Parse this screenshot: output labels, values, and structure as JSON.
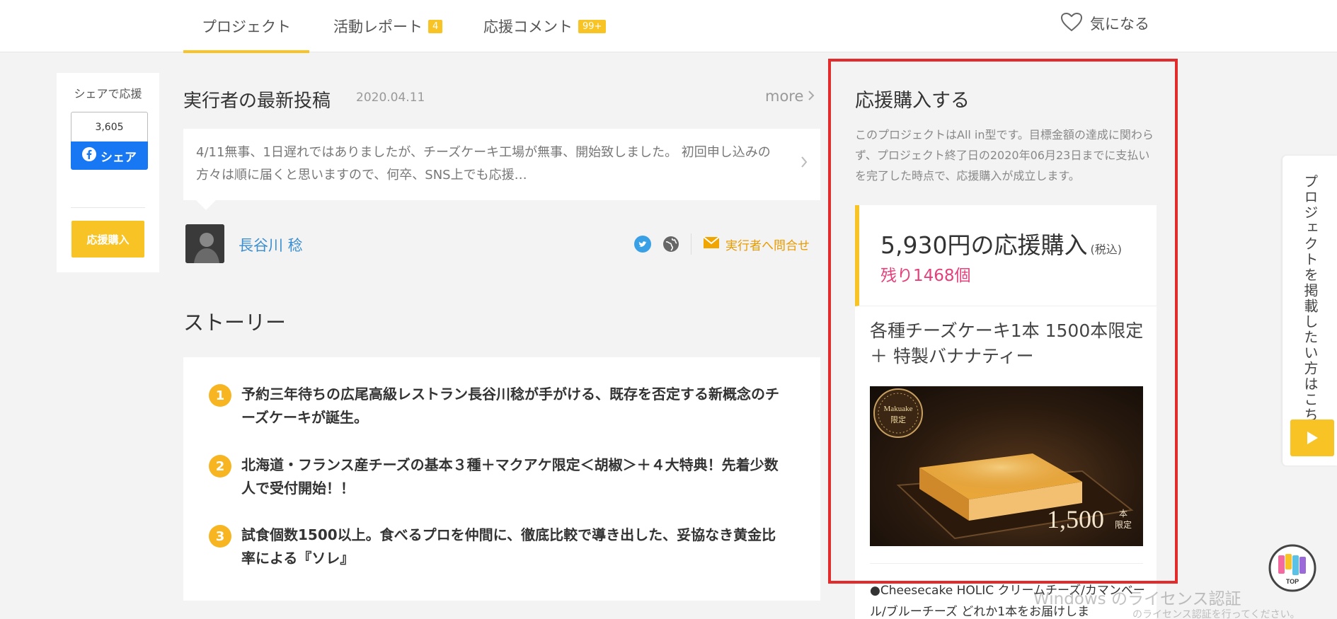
{
  "nav": {
    "tabs": [
      {
        "label": "プロジェクト",
        "badge": ""
      },
      {
        "label": "活動レポート",
        "badge": "4"
      },
      {
        "label": "応援コメント",
        "badge": "99+"
      }
    ],
    "favorite_label": "気になる"
  },
  "share": {
    "title": "シェアで応援",
    "count": "3,605",
    "fb_label": "シェア",
    "buy_label": "応援購入"
  },
  "latest": {
    "title": "実行者の最新投稿",
    "date": "2020.04.11",
    "more_label": "more",
    "post_text": "4/11無事、1日遅れではありましたが、チーズケーキ工場が無事、開始致しました。 初回申し込みの方々は順に届くと思いますので、何卒、SNS上でも応援…"
  },
  "author": {
    "name": "長谷川 稔",
    "contact_label": "実行者へ問合せ"
  },
  "story": {
    "title": "ストーリー",
    "items": [
      {
        "num": "1",
        "text": "予約三年待ちの広尾高級レストラン長谷川稔が手がける、既存を否定する新概念のチーズケーキが誕生。"
      },
      {
        "num": "2",
        "text": "北海道・フランス産チーズの基本３種＋マクアケ限定＜胡椒＞＋４大特典！先着少数人で受付開始！！"
      },
      {
        "num": "3",
        "text": "試食個数1500以上。食べるプロを仲間に、徹底比較で導き出した、妥協なき黄金比率による『ソレ』"
      }
    ]
  },
  "purchase": {
    "title": "応援購入する",
    "description": "このプロジェクトはAll in型です。目標金額の達成に関わらず、プロジェクト終了日の2020年06月23日までに支払いを完了した時点で、応援購入が成立します。",
    "reward": {
      "price": "5,930円の応援購入",
      "tax": "(税込)",
      "remaining": "残り1468個",
      "name": "各種チーズケーキ1本 1500本限定 ＋ 特製バナナティー",
      "image_badge_line1": "Makuake",
      "image_badge_line2": "限定",
      "image_count": "1,500",
      "image_count_unit1": "本",
      "image_count_unit2": "限定",
      "detail": "●Cheesecake HOLIC クリームチーズ/カマンベール/ブルーチーズ どれか1本をお届けしま"
    }
  },
  "side_tab": {
    "label": "プロジェクトを掲載したい方はこちら"
  },
  "top_button": {
    "label": "TOP"
  },
  "watermark": {
    "line1": "Windows のライセンス認証",
    "line2": "のライセンス認証を行ってください。"
  },
  "colors": {
    "accent": "#f7c325",
    "link": "#3b8fd0",
    "remaining": "#e4407b",
    "highlight_frame": "#e32b2b",
    "facebook": "#1877f2"
  }
}
